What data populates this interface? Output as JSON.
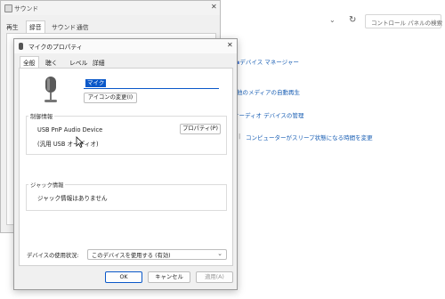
{
  "sound_window": {
    "title": "サウンド",
    "close": "✕",
    "tabs": [
      "再生",
      "録音",
      "サウンド",
      "通信"
    ]
  },
  "control_panel": {
    "search_placeholder": "コントロール パネルの検索",
    "chevron": "⌄",
    "refresh": "↻",
    "links": {
      "device_manager": "デバイス マネージャー",
      "autoplay": "他のメディアの自動再生",
      "audio_devices": "オーディオ デバイスの管理",
      "sleep": "コンピューターがスリープ状態になる時間を変更",
      "separator": "|"
    }
  },
  "dialog": {
    "title": "マイクのプロパティ",
    "close": "✕",
    "tabs": {
      "general": "全般",
      "listen": "聴く",
      "levels": "レベル",
      "advanced": "詳細"
    },
    "device_name": "マイク",
    "change_icon": "アイコンの変更(I)",
    "controller_info": {
      "label": "制御情報",
      "device": "USB PnP Audio Device",
      "driver": "(汎用 USB オーディオ)",
      "properties_button": "プロパティ(P)"
    },
    "jack_info": {
      "label": "ジャック情報",
      "text": "ジャック情報はありません"
    },
    "device_usage": {
      "label": "デバイスの使用状況:",
      "value": "このデバイスを使用する (有効)",
      "chevron": "⌄"
    },
    "buttons": {
      "ok": "OK",
      "cancel": "キャンセル",
      "apply": "適用(A)"
    }
  }
}
